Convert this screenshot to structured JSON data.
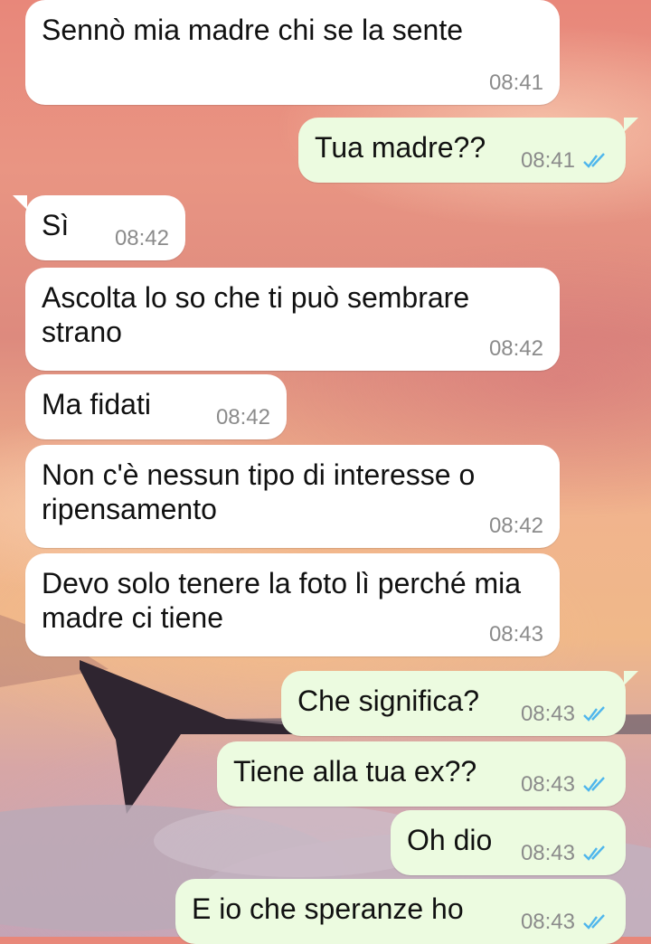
{
  "background": {
    "description_icon": "sunset-airplane-wing-wallpaper"
  },
  "colors": {
    "incoming_bubble": "#ffffff",
    "outgoing_bubble": "#ecfbe0",
    "read_ticks": "#4fb6ec",
    "time": "#8b8b8b"
  },
  "messages": [
    {
      "text": "Sennò mia madre chi se la sente",
      "time": "08:41",
      "direction": "in"
    },
    {
      "text": "Tua madre??",
      "time": "08:41",
      "direction": "out",
      "status": "read"
    },
    {
      "text": "Sì",
      "time": "08:42",
      "direction": "in"
    },
    {
      "text": "Ascolta lo so che ti può sembrare strano",
      "time": "08:42",
      "direction": "in"
    },
    {
      "text": "Ma fidati",
      "time": "08:42",
      "direction": "in"
    },
    {
      "text": "Non c'è nessun tipo di interesse o ripensamento",
      "time": "08:42",
      "direction": "in"
    },
    {
      "text": "Devo solo tenere la foto lì perché mia madre ci tiene",
      "time": "08:43",
      "direction": "in"
    },
    {
      "text": "Che significa?",
      "time": "08:43",
      "direction": "out",
      "status": "read"
    },
    {
      "text": "Tiene alla tua ex??",
      "time": "08:43",
      "direction": "out",
      "status": "read"
    },
    {
      "text": "Oh dio",
      "time": "08:43",
      "direction": "out",
      "status": "read"
    },
    {
      "text": "E io che speranze ho",
      "time": "08:43",
      "direction": "out",
      "status": "read"
    }
  ]
}
